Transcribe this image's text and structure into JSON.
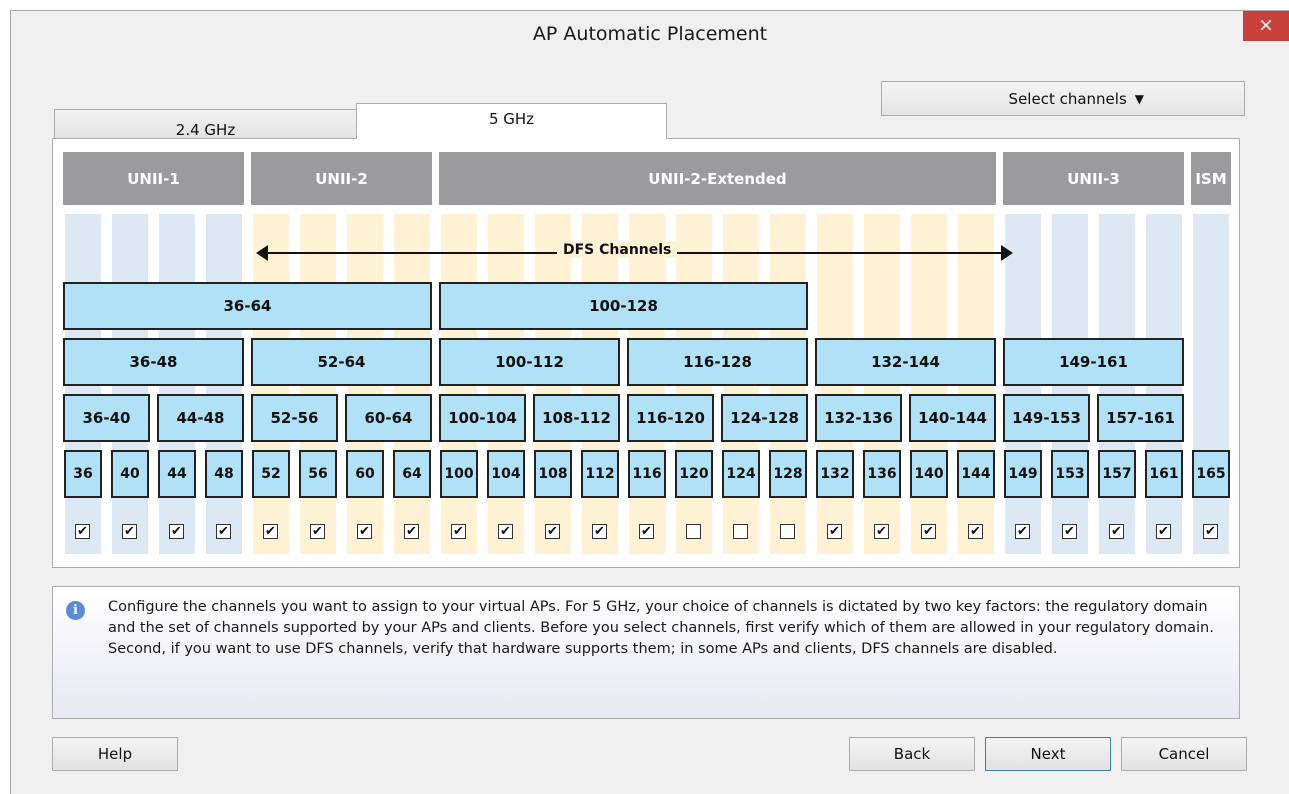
{
  "window": {
    "title": "AP Automatic Placement",
    "close_label": "×"
  },
  "select_channels": {
    "label": "Select channels",
    "arrow": "▼"
  },
  "tabs": [
    {
      "label": "2.4 GHz",
      "active": false
    },
    {
      "label": "5 GHz",
      "active": true
    }
  ],
  "bands": [
    "UNII-1",
    "UNII-2",
    "UNII-2-Extended",
    "UNII-3",
    "ISM"
  ],
  "dfs_label": "DFS Channels",
  "groups_160": [
    "36-64",
    "100-128"
  ],
  "groups_80": [
    "36-48",
    "52-64",
    "100-112",
    "116-128",
    "132-144",
    "149-161"
  ],
  "groups_40": [
    "36-40",
    "44-48",
    "52-56",
    "60-64",
    "100-104",
    "108-112",
    "116-120",
    "124-128",
    "132-136",
    "140-144",
    "149-153",
    "157-161"
  ],
  "channels": [
    {
      "num": "36",
      "checked": true
    },
    {
      "num": "40",
      "checked": true
    },
    {
      "num": "44",
      "checked": true
    },
    {
      "num": "48",
      "checked": true
    },
    {
      "num": "52",
      "checked": true
    },
    {
      "num": "56",
      "checked": true
    },
    {
      "num": "60",
      "checked": true
    },
    {
      "num": "64",
      "checked": true
    },
    {
      "num": "100",
      "checked": true
    },
    {
      "num": "104",
      "checked": true
    },
    {
      "num": "108",
      "checked": true
    },
    {
      "num": "112",
      "checked": true
    },
    {
      "num": "116",
      "checked": true
    },
    {
      "num": "120",
      "checked": false
    },
    {
      "num": "124",
      "checked": false
    },
    {
      "num": "128",
      "checked": false
    },
    {
      "num": "132",
      "checked": true
    },
    {
      "num": "136",
      "checked": true
    },
    {
      "num": "140",
      "checked": true
    },
    {
      "num": "144",
      "checked": true
    },
    {
      "num": "149",
      "checked": true
    },
    {
      "num": "153",
      "checked": true
    },
    {
      "num": "157",
      "checked": true
    },
    {
      "num": "161",
      "checked": true
    },
    {
      "num": "165",
      "checked": true
    }
  ],
  "check_glyph": "✔",
  "info": {
    "icon": "info-icon",
    "icon_glyph": "i",
    "text": "Configure the channels you want to assign to your virtual APs. For 5 GHz, your choice of channels is dictated by two key factors: the regulatory domain and the set of channels supported by your APs and clients. Before you select channels, first verify which of them are allowed in your regulatory domain. Second, if you want to use DFS channels, verify that hardware supports them; in some APs and clients, DFS channels are disabled."
  },
  "buttons": {
    "help": "Help",
    "back": "Back",
    "next": "Next",
    "cancel": "Cancel"
  },
  "colors": {
    "band_header": "#9b9b9e",
    "non_dfs_column": "#dce8f4",
    "dfs_column": "#fff2d4",
    "channel_box": "#b1e1f6",
    "close_button": "#c7413a"
  }
}
